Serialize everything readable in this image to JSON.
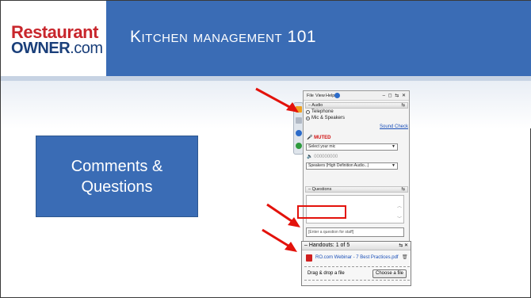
{
  "logo": {
    "line1": "Restaurant",
    "line2_bold": "OWNER",
    "line2_thin": ".com"
  },
  "slide": {
    "title": "Kitchen management 101",
    "box_line1": "Comments &",
    "box_line2": "Questions"
  },
  "panel": {
    "menu": [
      "File",
      "View",
      "Help"
    ],
    "window_buttons": "– ◻ ⇆ ✕",
    "audio": {
      "section_label": "Audio",
      "opt_telephone": "Telephone",
      "opt_mic": "Mic & Speakers",
      "sound_check": "Sound Check",
      "muted": "MUTED",
      "mic_select": "Select your mic",
      "level": "000000000",
      "speakers_select": "Speakers (High Definition Audio...)"
    },
    "questions": {
      "section_label": "Questions",
      "input_placeholder": "[Enter a question for staff]"
    }
  },
  "handouts": {
    "header": "Handouts: 1 of 5",
    "file_name": "RO.com Webinar - 7 Best Practices.pdf",
    "drag_text": "Drag & drop a file",
    "choose_label": "Choose a file"
  },
  "colors": {
    "brand_blue": "#3a6cb5",
    "brand_red": "#c8262c",
    "arrow_red": "#e3120b"
  }
}
